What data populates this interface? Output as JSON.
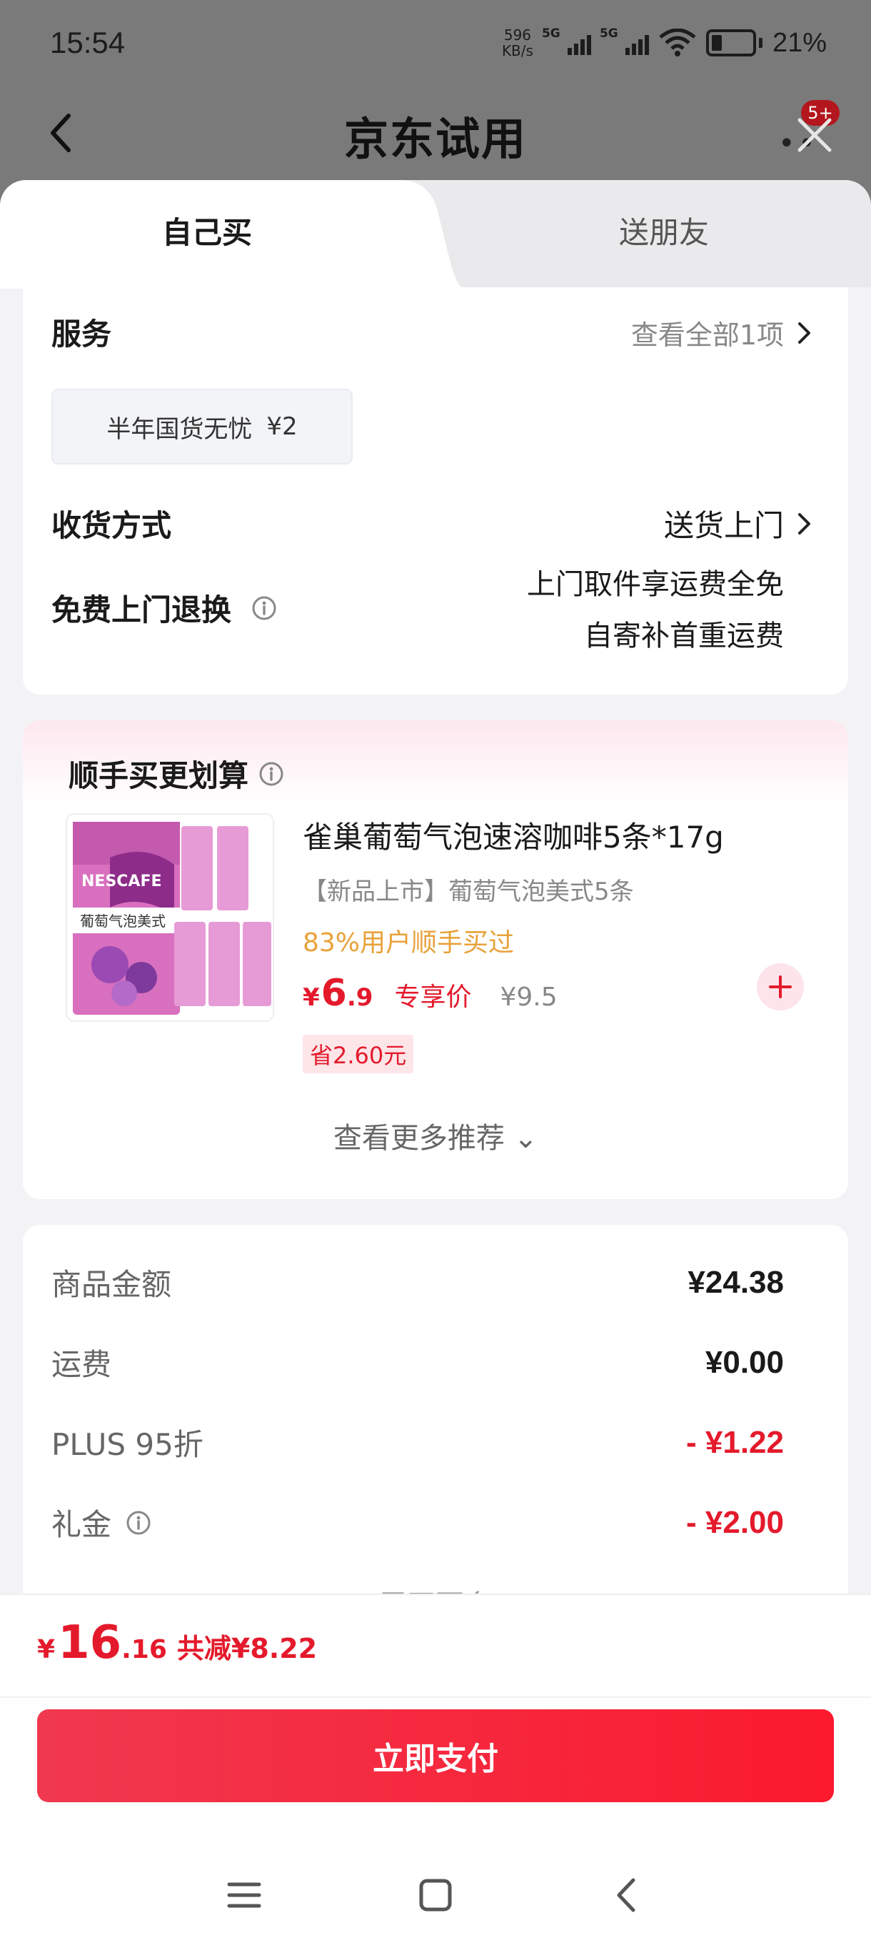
{
  "status_bar": {
    "time": "15:54",
    "net_speed_value": "596",
    "net_speed_unit": "KB/s",
    "sim1_tag": "5G",
    "sim2_tag": "5G",
    "battery": "21%"
  },
  "header": {
    "title": "京东试用",
    "notification_badge": "5+"
  },
  "tabs": [
    {
      "label": "自己买",
      "active": true
    },
    {
      "label": "送朋友",
      "active": false
    }
  ],
  "service": {
    "label": "服务",
    "view_all": "查看全部1项",
    "chip": {
      "name": "半年国货无忧",
      "price": "¥2"
    }
  },
  "delivery": {
    "label": "收货方式",
    "value": "送货上门"
  },
  "free_return": {
    "label": "免费上门退换",
    "line1": "上门取件享运费全免",
    "line2": "自寄补首重运费"
  },
  "addon": {
    "title": "顺手买更划算",
    "product": {
      "name": "雀巢葡萄气泡速溶咖啡5条*17g",
      "subtitle": "【新品上市】葡萄气泡美式5条",
      "users": "83%用户顺手买过",
      "price_yen": "¥",
      "price_int": "6",
      "price_dec": ".9",
      "price_tag": "专享价",
      "orig_price": "¥9.5",
      "save": "省2.60元",
      "image_brand": "NESCAFE",
      "image_text": "葡萄气泡美式"
    },
    "see_more": "查看更多推荐"
  },
  "cost": {
    "rows": [
      {
        "label": "商品金额",
        "value": "¥24.38",
        "red": false
      },
      {
        "label": "运费",
        "value": "¥0.00",
        "red": false
      },
      {
        "label": "PLUS 95折",
        "value": "- ¥1.22",
        "red": true
      },
      {
        "label": "礼金",
        "value": "- ¥2.00",
        "red": true
      }
    ],
    "collapsed_hint": "展开更多"
  },
  "payment": {
    "yen": "¥",
    "total_int": "16",
    "total_dec": ".16",
    "discount": "共减¥8.22",
    "pay_label": "立即支付"
  },
  "colors": {
    "accent_red": "#e41a2c",
    "pay_gradient_start": "#f0384f",
    "pay_gradient_end": "#fb1a2e",
    "user_stat_orange": "#e8a23a"
  }
}
